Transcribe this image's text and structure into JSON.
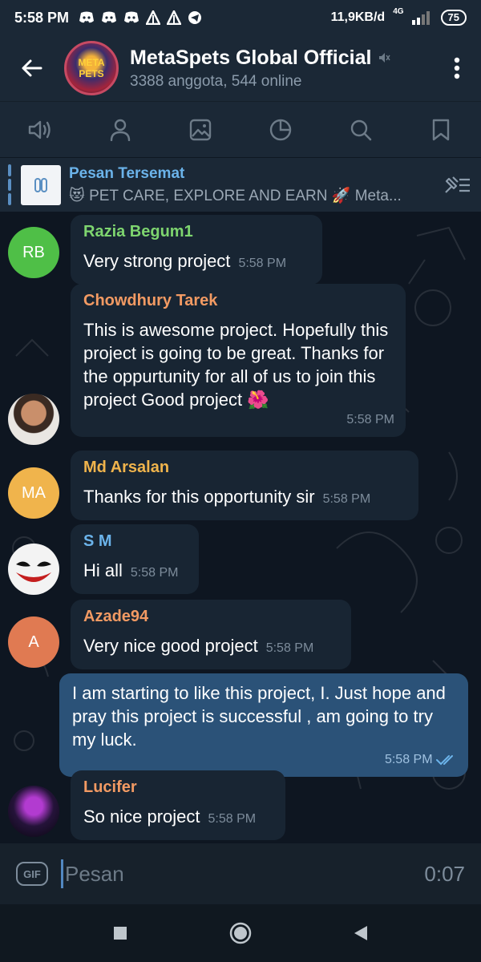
{
  "status_bar": {
    "time": "5:58 PM",
    "speed": "11,9KB/d",
    "network": "4G",
    "battery": "75"
  },
  "header": {
    "title": "MetaSpets Global Official",
    "subtitle": "3388 anggota, 544 online",
    "avatar_text": "META PETS",
    "icons": [
      "back-arrow-icon",
      "mute-icon",
      "more-vert-icon"
    ]
  },
  "action_bar": {
    "icons": [
      "voice-chat-icon",
      "members-icon",
      "media-icon",
      "stats-icon",
      "search-icon",
      "bookmark-icon"
    ]
  },
  "pinned": {
    "title": "Pesan Tersemat",
    "body": "😻 PET CARE, EXPLORE AND EARN 🚀 Meta..."
  },
  "messages": [
    {
      "sender": "Razia Begum1",
      "text": "Very strong project",
      "time": "5:58 PM",
      "initials": "RB",
      "avatar_color": "#4fbf47",
      "name_color": "#7ed56f"
    },
    {
      "sender": "Chowdhury Tarek",
      "text": "This is awesome project. Hopefully this project is going to be great. Thanks for the oppurtunity for all of us to join this project Good project 🌺",
      "time": "5:58 PM",
      "name_color": "#f29a63"
    },
    {
      "sender": "Md Arsalan",
      "text": "Thanks for this opportunity sir",
      "time": "5:58 PM",
      "initials": "MA",
      "avatar_color": "#f0b44c",
      "name_color": "#f0b44c"
    },
    {
      "sender": "S M",
      "text": "Hi all",
      "time": "5:58 PM",
      "name_color": "#6bb3ea"
    },
    {
      "sender": "Azade94",
      "text": "Very nice good project",
      "time": "5:58 PM",
      "initials": "A",
      "avatar_color": "#e07a52",
      "name_color": "#f29a63"
    },
    {
      "text": "I am starting to like this project, I. Just hope and pray this project is successful , am going to try my luck.",
      "time": "5:58 PM"
    },
    {
      "sender": "Lucifer",
      "text": "So nice project",
      "time": "5:58 PM",
      "name_color": "#f29a63"
    }
  ],
  "input": {
    "placeholder": "Pesan",
    "gif_label": "GIF",
    "record_time": "0:07"
  },
  "colors": {
    "accent": "#5288c1",
    "outgoing_bubble": "#2b5278",
    "incoming_bubble": "#182533"
  }
}
